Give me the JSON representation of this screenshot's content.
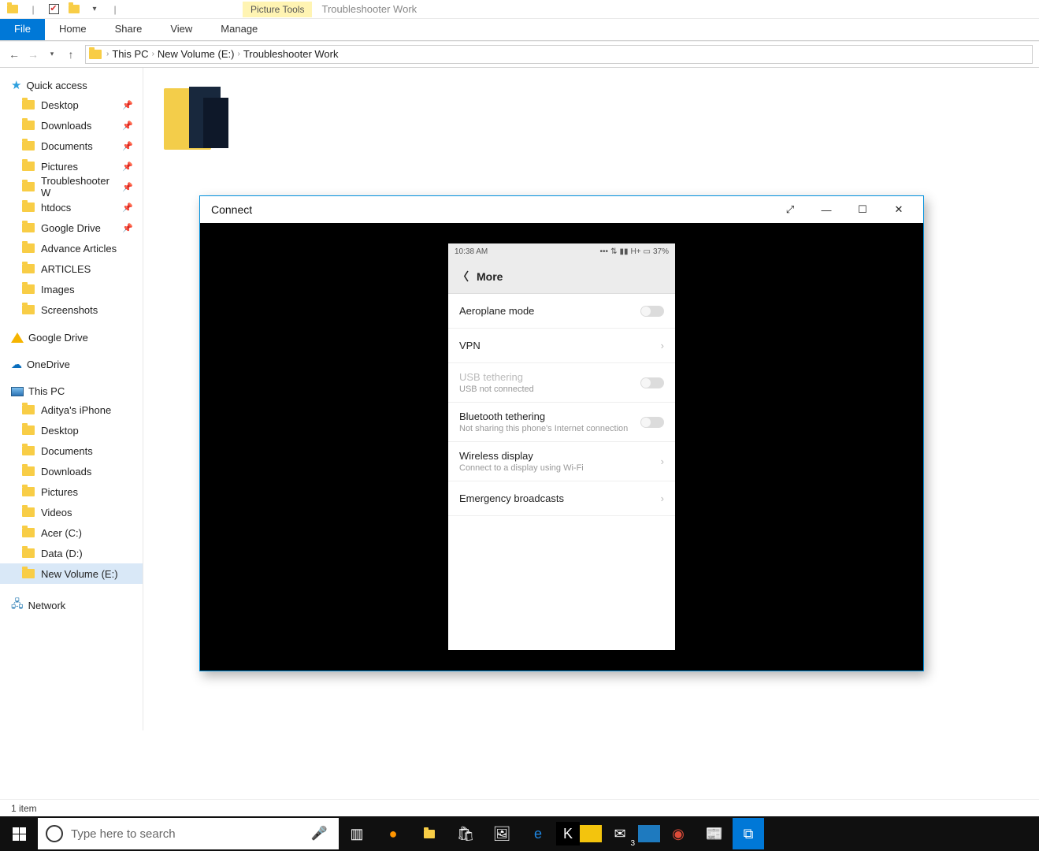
{
  "titlebar": {
    "context_tab": "Picture Tools",
    "window_title": "Troubleshooter Work"
  },
  "ribbon": {
    "file": "File",
    "home": "Home",
    "share": "Share",
    "view": "View",
    "manage": "Manage"
  },
  "breadcrumbs": {
    "items": [
      "This PC",
      "New Volume (E:)",
      "Troubleshooter Work"
    ]
  },
  "nav": {
    "quick_access": "Quick access",
    "qa_items": [
      {
        "label": "Desktop",
        "pin": true
      },
      {
        "label": "Downloads",
        "pin": true
      },
      {
        "label": "Documents",
        "pin": true
      },
      {
        "label": "Pictures",
        "pin": true
      },
      {
        "label": "Troubleshooter W",
        "pin": true
      },
      {
        "label": "htdocs",
        "pin": true
      },
      {
        "label": "Google Drive",
        "pin": true
      },
      {
        "label": "Advance Articles",
        "pin": false
      },
      {
        "label": "ARTICLES",
        "pin": false
      },
      {
        "label": "Images",
        "pin": false
      },
      {
        "label": "Screenshots",
        "pin": false
      }
    ],
    "gdrive": "Google Drive",
    "onedrive": "OneDrive",
    "this_pc": "This PC",
    "pc_items": [
      "Aditya's iPhone",
      "Desktop",
      "Documents",
      "Downloads",
      "Pictures",
      "Videos",
      "Acer (C:)",
      "Data (D:)",
      "New Volume (E:)"
    ],
    "network": "Network"
  },
  "status": {
    "text": "1 item"
  },
  "connect": {
    "title": "Connect"
  },
  "phone": {
    "time": "10:38 AM",
    "net": "H+",
    "battery": "37%",
    "header": "More",
    "rows": [
      {
        "title": "Aeroplane mode",
        "sub": "",
        "kind": "toggle",
        "disabled": false
      },
      {
        "title": "VPN",
        "sub": "",
        "kind": "arrow",
        "disabled": false
      },
      {
        "title": "USB tethering",
        "sub": "USB not connected",
        "kind": "toggle",
        "disabled": true
      },
      {
        "title": "Bluetooth tethering",
        "sub": "Not sharing this phone's Internet connection",
        "kind": "toggle",
        "disabled": false
      },
      {
        "title": "Wireless display",
        "sub": "Connect to a display using Wi-Fi",
        "kind": "arrow",
        "disabled": false
      },
      {
        "title": "Emergency broadcasts",
        "sub": "",
        "kind": "arrow",
        "disabled": false
      }
    ]
  },
  "search": {
    "placeholder": "Type here to search"
  },
  "mailbadge": "3"
}
